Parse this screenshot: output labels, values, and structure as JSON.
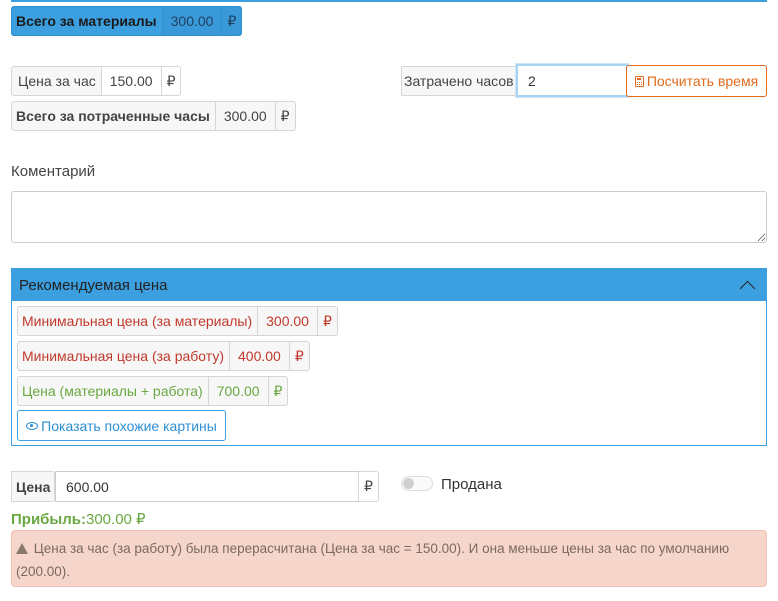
{
  "materials_total": {
    "label": "Всего за материалы",
    "value": "300.00",
    "currency": "₽"
  },
  "hourly": {
    "label": "Цена за час",
    "value": "150.00",
    "currency": "₽"
  },
  "hours": {
    "label": "Затрачено часов",
    "value": "2",
    "calc_button": "Посчитать время"
  },
  "hours_total": {
    "label": "Всего за потраченные часы",
    "value": "300.00",
    "currency": "₽"
  },
  "comment": {
    "label": "Коментарий",
    "value": ""
  },
  "recommended": {
    "title": "Рекомендуемая цена",
    "min_materials": {
      "label": "Минимальная цена (за материалы)",
      "value": "300.00",
      "currency": "₽"
    },
    "min_work": {
      "label": "Минимальная цена (за работу)",
      "value": "400.00",
      "currency": "₽"
    },
    "combined": {
      "label": "Цена (материалы + работа)",
      "value": "700.00",
      "currency": "₽"
    },
    "show_similar": "Показать похожие картины"
  },
  "price": {
    "label": "Цена",
    "value": "600.00",
    "currency": "₽"
  },
  "sold": {
    "label": "Продана",
    "checked": false
  },
  "profit": {
    "label": "Прибыль:",
    "value": "300.00 ₽"
  },
  "alert": {
    "line1": "Цена за час (за работу) была перерасчитана (Цена за час = 150.00).  И она меньше цены за час по умолчанию",
    "line2": "(200.00)."
  },
  "colors": {
    "accent": "#3c9fe0",
    "orange": "#e06a1a",
    "red": "#c0392b",
    "green": "#6aa842",
    "alert_bg": "#f6d6cb"
  },
  "icons": [
    "calculator-icon",
    "chevron-up-icon",
    "eye-icon",
    "warning-icon"
  ]
}
